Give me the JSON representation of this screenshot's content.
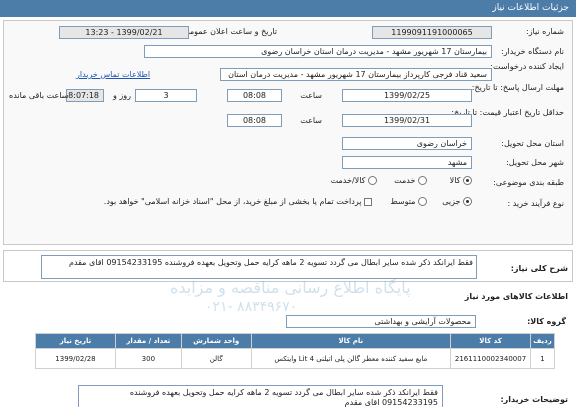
{
  "page": {
    "title": "جزئیات اطلاعات نیاز"
  },
  "form": {
    "need_number_label": "شماره نیاز:",
    "need_number": "1199091191000065",
    "announce_label": "تاریخ و ساعت اعلان عمومی:",
    "announce_value": "1399/02/21 - 13:23",
    "buyer_org_label": "نام دستگاه خریدار:",
    "buyer_org": "بیمارستان 17 شهریور مشهد - مدیریت درمان استان خراسان رضوی",
    "creator_label": "ایجاد کننده درخواست:",
    "creator": "سعید قناد فرجی کارپرداز بیمارستان 17 شهریور مشهد - مدیریت درمان استان",
    "buyer_contact_link": "اطلاعات تماس خریدار",
    "response_deadline_label": "مهلت ارسال پاسخ: تا تاریخ:",
    "response_date": "1399/02/25",
    "time_label": "ساعت",
    "response_time": "08:08",
    "days_value": "3",
    "days_label": "روز و",
    "remaining_time": "18:07:18",
    "remaining_label": "ساعت باقی مانده",
    "price_validity_label": "حداقل تاریخ اعتبار قیمت: تا تاریخ:",
    "validity_date": "1399/02/31",
    "validity_time_label": "ساعت",
    "validity_time": "08:08",
    "province_label": "استان محل تحویل:",
    "province": "خراسان رضوی",
    "city_label": "شهر محل تحویل:",
    "city": "مشهد",
    "category_label": "طبقه بندی موضوعی:",
    "category_options": [
      "کالا",
      "خدمت",
      "کالا/خدمت"
    ],
    "process_label": "نوع فرآیند خرید :",
    "process_options": [
      "جزیی",
      "متوسط"
    ],
    "payment_note": "پرداخت تمام یا بخشی از مبلغ خرید، از محل \"اسناد خزانه اسلامی\" خواهد بود."
  },
  "description": {
    "label": "شرح کلی نیاز:",
    "text": "فقط ایرانکد ذکر شده سایر ابطال می گردد تسویه 2 ماهه کرایه حمل وتحویل بعهده فروشنده 09154233195 اقای مقدم"
  },
  "goods": {
    "section_label": "اطلاعات کالاهای مورد نیاز",
    "group_label": "گروه کالا:",
    "group_value": "محصولات آرایشی و بهداشتی",
    "columns": [
      "ردیف",
      "کد کالا",
      "نام کالا",
      "واحد شمارش",
      "تعداد / مقدار",
      "تاریخ نیاز"
    ],
    "rows": [
      [
        "1",
        "2161110002340007",
        "مایع سفید کننده معطر گالن پلی اتیلنی Lit 4 وایتکس",
        "گالن",
        "300",
        "1399/02/28"
      ]
    ]
  },
  "buyer_notes": {
    "label": "توضیحات خریدار:",
    "text": "فقط ایرانکد ذکر شده سایر ابطال می گردد تسویه 2 ماهه کرایه حمل وتحویل بعهده فروشنده 09154233195 اقای مقدم"
  },
  "watermark": {
    "line1": "پایگاه اطلاع رسانی مناقصه و مزایده",
    "line2": "۰۲۱- ۸۸۳۴۹۶۷۰"
  }
}
